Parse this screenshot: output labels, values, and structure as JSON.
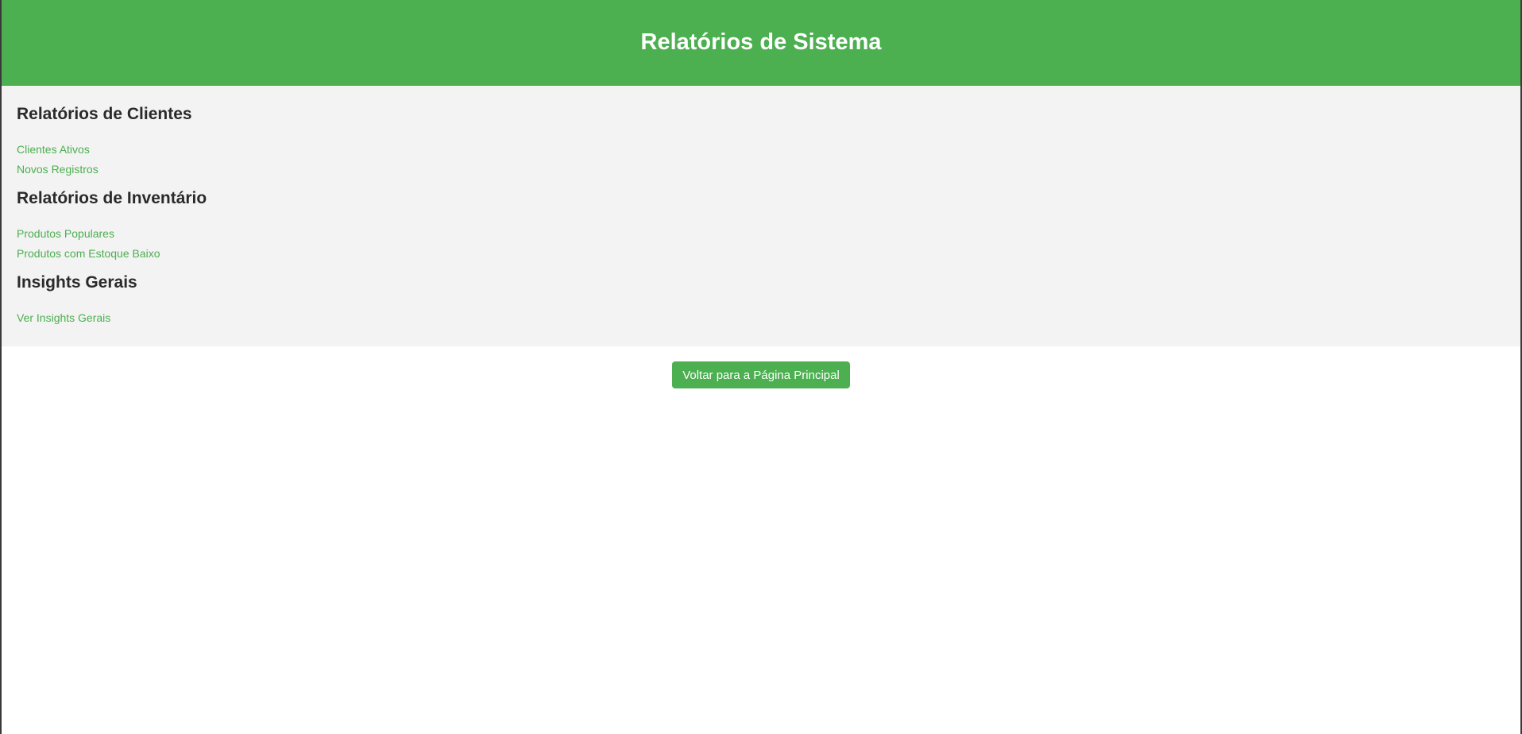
{
  "header": {
    "title": "Relatórios de Sistema"
  },
  "sections": [
    {
      "title": "Relatórios de Clientes",
      "links": [
        "Clientes Ativos",
        "Novos Registros"
      ]
    },
    {
      "title": "Relatórios de Inventário",
      "links": [
        "Produtos Populares",
        "Produtos com Estoque Baixo"
      ]
    },
    {
      "title": "Insights Gerais",
      "links": [
        "Ver Insights Gerais"
      ]
    }
  ],
  "footer": {
    "back_button_label": "Voltar para a Página Principal"
  },
  "colors": {
    "accent": "#4caf50",
    "content_background": "#f3f3f3",
    "heading_text": "#2a2a2a"
  }
}
